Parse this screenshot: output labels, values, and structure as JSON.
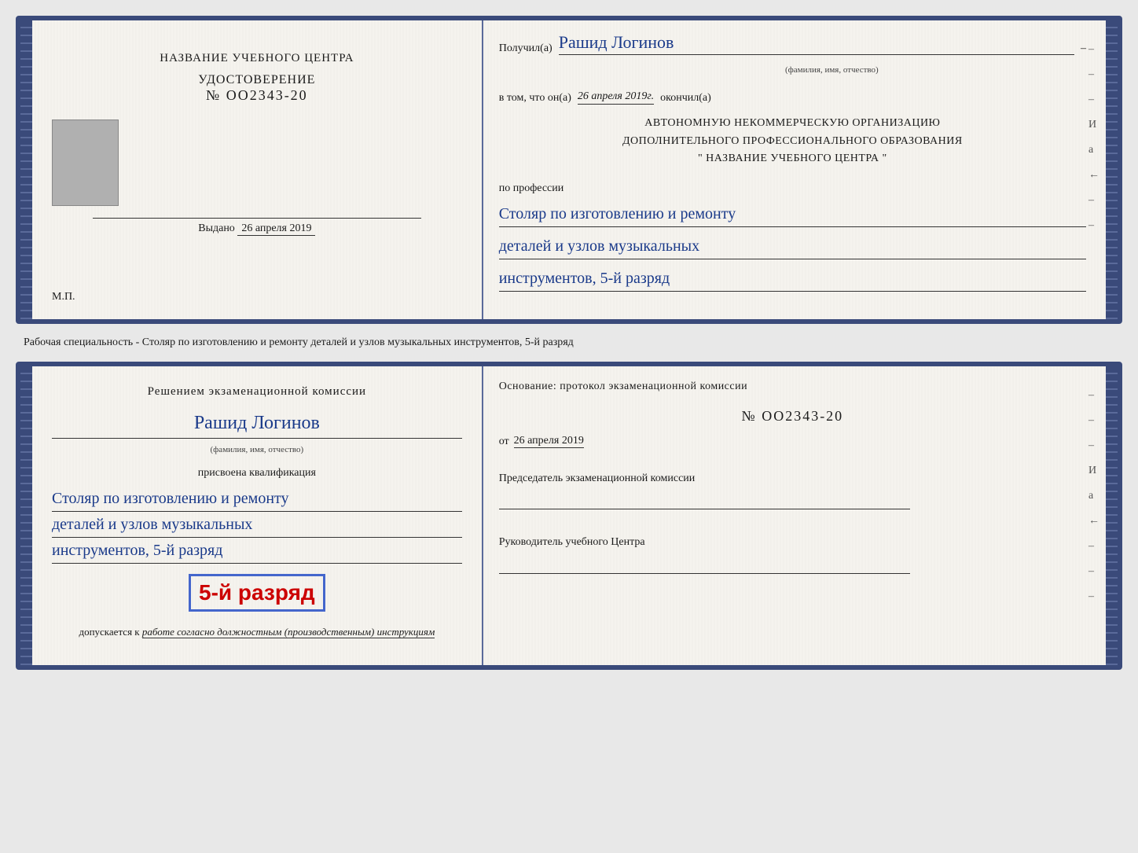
{
  "top_doc": {
    "left": {
      "center_title": "НАЗВАНИЕ УЧЕБНОГО ЦЕНТРА",
      "udost_label": "УДОСТОВЕРЕНИЕ",
      "udost_number": "№ OO2343-20",
      "issued_label": "Выдано",
      "issued_date": "26 апреля 2019",
      "mp_label": "М.П."
    },
    "right": {
      "recipient_prefix": "Получил(а)",
      "recipient_name": "Рашид Логинов",
      "recipient_sublabel": "(фамилия, имя, отчество)",
      "vtom_prefix": "в том, что он(а)",
      "vtom_date": "26 апреля 2019г.",
      "vtom_suffix": "окончил(а)",
      "org_line1": "АВТОНОМНУЮ НЕКОММЕРЧЕСКУЮ ОРГАНИЗАЦИЮ",
      "org_line2": "ДОПОЛНИТЕЛЬНОГО ПРОФЕССИОНАЛЬНОГО ОБРАЗОВАНИЯ",
      "org_line3": "\"   НАЗВАНИЕ УЧЕБНОГО ЦЕНТРА   \"",
      "profession_label": "по профессии",
      "profession_line1": "Столяр по изготовлению и ремонту",
      "profession_line2": "деталей и узлов музыкальных",
      "profession_line3": "инструментов, 5-й разряд"
    }
  },
  "between_label": "Рабочая специальность - Столяр по изготовлению и ремонту деталей и узлов музыкальных инструментов, 5-й разряд",
  "bottom_doc": {
    "left": {
      "komissia_title": "Решением экзаменационной комиссии",
      "name": "Рашид Логинов",
      "fio_sublabel": "(фамилия, имя, отчество)",
      "prisvoena": "присвоена квалификация",
      "kvalif_line1": "Столяр по изготовлению и ремонту",
      "kvalif_line2": "деталей и узлов музыкальных",
      "kvalif_line3": "инструментов, 5-й разряд",
      "rank_highlight": "5-й разряд",
      "dopuskaetsya_prefix": "допускается к",
      "dopuskaetsya_text": "работе согласно должностным (производственным) инструкциям"
    },
    "right": {
      "osnovanie_label": "Основание: протокол экзаменационной комиссии",
      "protocol_number": "№  OO2343-20",
      "ot_prefix": "от",
      "ot_date": "26 апреля 2019",
      "predsedatel_label": "Председатель экзаменационной комиссии",
      "rukovoditel_label": "Руководитель учебного Центра"
    }
  },
  "dashes": {
    "marks": [
      "-",
      "-",
      "-",
      "И",
      "а",
      "←",
      "-"
    ]
  }
}
